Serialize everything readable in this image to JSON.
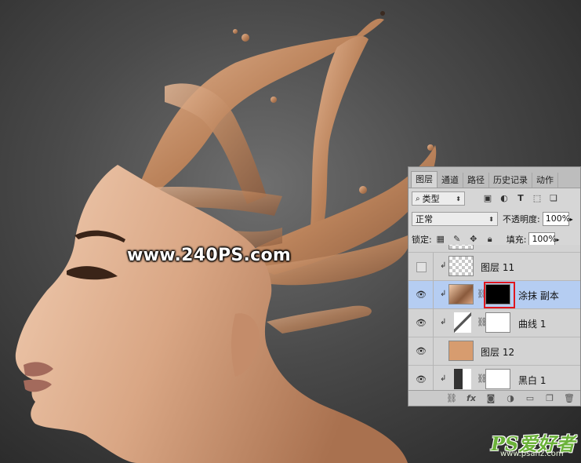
{
  "watermark": "www.240PS.com",
  "brand": {
    "logo": "PS爱好者",
    "url": "www.psahz.com"
  },
  "layers_panel": {
    "tabs": [
      "图层",
      "通道",
      "路径",
      "历史记录",
      "动作"
    ],
    "filter": {
      "label": "类型"
    },
    "blend_mode": "正常",
    "opacity": {
      "label": "不透明度:",
      "value": "100%"
    },
    "lock": {
      "label": "锁定:"
    },
    "fill": {
      "label": "填充:",
      "value": "100%"
    },
    "layers": [
      {
        "name": "图层 11",
        "visible": false,
        "clipped": true,
        "thumb": "checker",
        "selected": false
      },
      {
        "name": "涂抹 副本",
        "visible": true,
        "clipped": true,
        "thumb": "photo",
        "mask": "black",
        "selected": true
      },
      {
        "name": "曲线 1",
        "visible": true,
        "clipped": true,
        "thumb": "curves",
        "mask": "white",
        "selected": false
      },
      {
        "name": "图层 12",
        "visible": true,
        "clipped": false,
        "thumb": "color",
        "thumb_color": "#d79c6f",
        "selected": false
      },
      {
        "name": "黑白 1",
        "visible": true,
        "clipped": true,
        "thumb": "bw",
        "mask": "white",
        "selected": false
      }
    ],
    "bottom_icons": [
      "link-layers-icon",
      "fx-icon",
      "add-mask-icon",
      "adjustment-icon",
      "group-icon",
      "new-layer-icon",
      "delete-icon"
    ]
  },
  "colors": {
    "skin": "#d8a582",
    "splash": "#c0875e",
    "highlight_box": "#e0161e",
    "selected_row": "#b5cdf2",
    "logo_green": "#6bb23a"
  }
}
